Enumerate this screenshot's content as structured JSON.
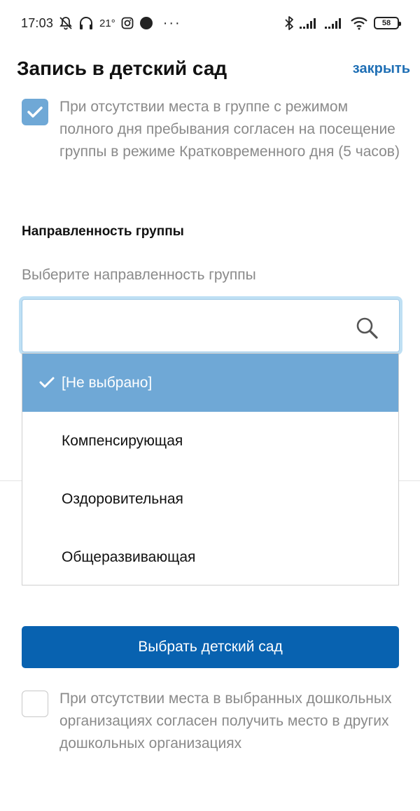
{
  "status_bar": {
    "time": "17:03",
    "temperature": "21°",
    "more": "···",
    "battery": "58",
    "icons": [
      "muted-bell-icon",
      "headphones-icon",
      "instagram-icon",
      "dot-icon",
      "bluetooth-icon",
      "signal-icon",
      "signal-icon",
      "wifi-icon",
      "battery-icon"
    ]
  },
  "header": {
    "title": "Запись в детский сад",
    "close_label": "закрыть"
  },
  "consent_short_day": {
    "checked": true,
    "text": "При отсутствии места в группе с режимом полного дня пребывания согласен на посещение группы в режиме Кратковременного дня (5 часов)"
  },
  "group_focus": {
    "label": "Направленность группы",
    "hint": "Выберите направленность группы",
    "search_value": "",
    "options": [
      {
        "label": "[Не выбрано]",
        "selected": true
      },
      {
        "label": "Компенсирующая",
        "selected": false
      },
      {
        "label": "Оздоровительная",
        "selected": false
      },
      {
        "label": "Общеразвивающая",
        "selected": false
      }
    ]
  },
  "choose_button": "Выбрать детский сад",
  "consent_other_orgs": {
    "checked": false,
    "text": "При отсутствии места в выбранных дошкольных организациях согласен получить место в других дошкольных организациях"
  },
  "colors": {
    "accent": "#0862b0",
    "link": "#1f6fb5",
    "selected": "#6fa8d6",
    "muted_text": "#8a8a8a"
  }
}
